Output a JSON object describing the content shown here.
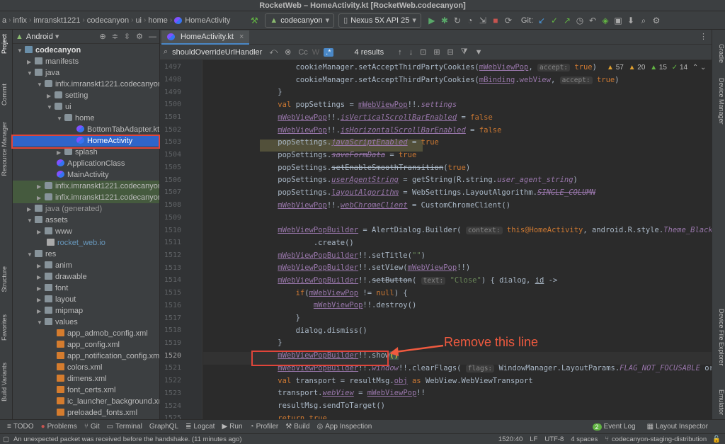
{
  "window": {
    "title": "RocketWeb – HomeActivity.kt [RocketWeb.codecanyon]"
  },
  "breadcrumbs": [
    "a",
    "infix",
    "imranskt1221",
    "codecanyon",
    "ui",
    "home",
    "HomeActivity"
  ],
  "toolbar": {
    "run_config": "codecanyon",
    "device": "Nexus 5X API 25",
    "git_label": "Git:"
  },
  "left_tools": [
    "Project",
    "Commit",
    "Resource Manager",
    "Structure",
    "Favorites",
    "Build Variants"
  ],
  "right_tools": [
    "Gradle",
    "Device Manager",
    "Device File Explorer",
    "Emulator"
  ],
  "project_panel": {
    "view": "Android"
  },
  "tree": [
    {
      "label": "codecanyon",
      "icon": "module-folder-icon"
    },
    {
      "label": "manifests",
      "icon": "folder-icon"
    },
    {
      "label": "java",
      "icon": "folder-icon"
    },
    {
      "label": "infix.imranskt1221.codecanyon",
      "icon": "package-icon"
    },
    {
      "label": "setting",
      "icon": "package-icon"
    },
    {
      "label": "ui",
      "icon": "package-icon"
    },
    {
      "label": "home",
      "icon": "package-icon"
    },
    {
      "label": "BottomTabAdapter.kt",
      "icon": "kotlin-file-icon"
    },
    {
      "label": "HomeActivity",
      "icon": "kotlin-class-icon"
    },
    {
      "label": "splash",
      "icon": "package-icon"
    },
    {
      "label": "ApplicationClass",
      "icon": "kotlin-class-icon"
    },
    {
      "label": "MainActivity",
      "icon": "kotlin-class-icon"
    },
    {
      "label": "infix.imranskt1221.codecanyon",
      "icon": "package-icon"
    },
    {
      "label": "infix.imranskt1221.codecanyon",
      "icon": "package-icon"
    },
    {
      "label": "java (generated)",
      "icon": "folder-icon"
    },
    {
      "label": "assets",
      "icon": "folder-icon"
    },
    {
      "label": "www",
      "icon": "folder-icon"
    },
    {
      "label": "rocket_web.io",
      "icon": "file-icon"
    },
    {
      "label": "res",
      "icon": "folder-icon"
    },
    {
      "label": "anim",
      "icon": "folder-icon"
    },
    {
      "label": "drawable",
      "icon": "folder-icon"
    },
    {
      "label": "font",
      "icon": "folder-icon"
    },
    {
      "label": "layout",
      "icon": "folder-icon"
    },
    {
      "label": "mipmap",
      "icon": "folder-icon"
    },
    {
      "label": "values",
      "icon": "folder-icon"
    },
    {
      "label": "app_admob_config.xml",
      "icon": "xml-file-icon"
    },
    {
      "label": "app_config.xml",
      "icon": "xml-file-icon"
    },
    {
      "label": "app_notification_config.xml",
      "icon": "xml-file-icon"
    },
    {
      "label": "colors.xml",
      "icon": "xml-file-icon"
    },
    {
      "label": "dimens.xml",
      "icon": "xml-file-icon"
    },
    {
      "label": "font_certs.xml",
      "icon": "xml-file-icon"
    },
    {
      "label": "ic_launcher_background.xml",
      "icon": "xml-file-icon"
    },
    {
      "label": "preloaded_fonts.xml",
      "icon": "xml-file-icon"
    }
  ],
  "editor": {
    "tab": "HomeActivity.kt",
    "search_query": "shouldOverrideUrlHandler",
    "search_results": "4 results",
    "inspections": {
      "warnings": "57",
      "weak": "20",
      "typos": "15",
      "ok": "14"
    },
    "line_numbers": [
      "1497",
      "1498",
      "1499",
      "1500",
      "1501",
      "1502",
      "1503",
      "1504",
      "1505",
      "1506",
      "1507",
      "1508",
      "1509",
      "1510",
      "1511",
      "1512",
      "1513",
      "1514",
      "1515",
      "1516",
      "1517",
      "1518",
      "1519",
      "1520",
      "1521",
      "1522",
      "1523",
      "1524",
      "1525"
    ],
    "hints": {
      "accept": "accept:",
      "context": "context:",
      "text": "text:",
      "flags": "flags:"
    }
  },
  "annotation": {
    "text": "Remove this line"
  },
  "tool_tabs": [
    "TODO",
    "Problems",
    "Git",
    "Terminal",
    "GraphQL",
    "Logcat",
    "Run",
    "Profiler",
    "Build",
    "App Inspection",
    "Event Log",
    "Layout Inspector"
  ],
  "event_log_count": "2",
  "status": {
    "message": "An unexpected packet was received before the handshake. (11 minutes ago)",
    "position": "1520:40",
    "line_sep": "LF",
    "encoding": "UTF-8",
    "indent": "4 spaces",
    "branch": "codecanyon-staging-distribution"
  },
  "colors": {
    "accent": "#2f65ca",
    "annotation": "#ef5a3f",
    "background": "#2b2b2b"
  }
}
